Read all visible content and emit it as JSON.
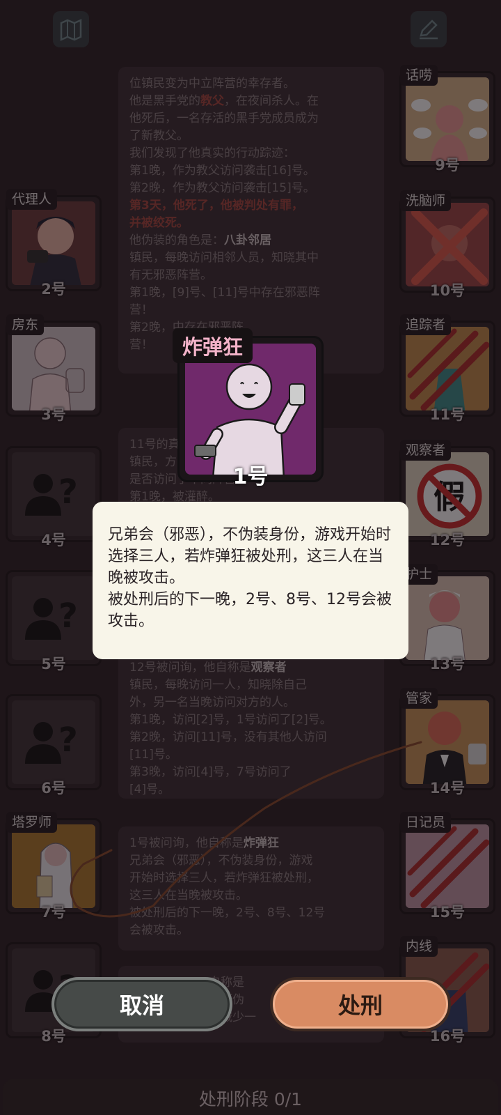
{
  "top_icons": {
    "left": "map-icon",
    "right": "note-icon"
  },
  "log_cards": [
    {
      "lines": [
        [
          {
            "t": "位镇民变为中立阵营的幸存者。",
            "c": ""
          }
        ],
        [
          {
            "t": "他是黑手党的",
            "c": ""
          },
          {
            "t": "教父",
            "c": "red"
          },
          {
            "t": "，在夜间杀人。在",
            "c": ""
          }
        ],
        [
          {
            "t": "他死后，一名存活的黑手党成员成为",
            "c": ""
          }
        ],
        [
          {
            "t": "了新教父。",
            "c": ""
          }
        ],
        [
          {
            "t": "我们发现了他真实的行动踪迹：",
            "c": ""
          }
        ],
        [
          {
            "t": "第1晚，作为教父访问袭击[16]号。",
            "c": ""
          }
        ],
        [
          {
            "t": "第2晚，作为教父访问袭击[15]号。",
            "c": ""
          }
        ],
        [
          {
            "t": "第3天，他死了，他被判处有罪，",
            "c": "red"
          }
        ],
        [
          {
            "t": "并被绞死。",
            "c": "red"
          }
        ],
        [
          {
            "t": " ",
            "c": ""
          }
        ],
        [
          {
            "t": "他伪装的角色是：",
            "c": ""
          },
          {
            "t": "八卦邻居",
            "c": "hl"
          }
        ],
        [
          {
            "t": "镇民，每晚访问相邻人员，知晓其中",
            "c": ""
          }
        ],
        [
          {
            "t": "有无邪恶阵营。",
            "c": ""
          }
        ],
        [
          {
            "t": "第1晚，[9]号、[11]号中存在邪恶阵",
            "c": ""
          }
        ],
        [
          {
            "t": "营！",
            "c": ""
          }
        ],
        [
          {
            "t": "第2晚，",
            "c": ""
          },
          {
            "t": "中存在邪恶阵",
            "c": ""
          }
        ],
        [
          {
            "t": "营！",
            "c": ""
          }
        ]
      ]
    },
    {
      "lines": [
        [
          {
            "t": "11号的真",
            "c": ""
          }
        ],
        [
          {
            "t": "镇民，",
            "c": ""
          },
          {
            "t": "方当晚",
            "c": ""
          }
        ],
        [
          {
            "t": "是否访问了不同阵营。",
            "c": ""
          }
        ],
        [
          {
            "t": "第1晚，被灌醉。",
            "c": ""
          }
        ]
      ]
    },
    {
      "lines": [
        [
          {
            "t": "12号被问询，他自称是",
            "c": ""
          },
          {
            "t": "观察者",
            "c": "hl"
          }
        ],
        [
          {
            "t": "镇民，每晚访问一人，知晓除自己",
            "c": ""
          }
        ],
        [
          {
            "t": "外，另一名当晚访问对方的人。",
            "c": ""
          }
        ],
        [
          {
            "t": "第1晚，访问[2]号，1号访问了[2]号。",
            "c": ""
          }
        ],
        [
          {
            "t": "第2晚，访问[11]号，没有其他人访问",
            "c": ""
          }
        ],
        [
          {
            "t": "[11]号。",
            "c": ""
          }
        ],
        [
          {
            "t": "第3晚，访问[4]号，7号访问了",
            "c": ""
          }
        ],
        [
          {
            "t": "[4]号。",
            "c": ""
          }
        ]
      ]
    },
    {
      "lines": [
        [
          {
            "t": "1号被问询，他自称是",
            "c": ""
          },
          {
            "t": "炸弹狂",
            "c": "hl"
          }
        ],
        [
          {
            "t": "兄弟会（邪恶），不伪装身份，游戏",
            "c": ""
          }
        ],
        [
          {
            "t": "开始时选择三人，若炸弹狂被处刑，",
            "c": ""
          }
        ],
        [
          {
            "t": "这三人在当晚被攻击。",
            "c": ""
          }
        ],
        [
          {
            "t": "被处刑后的下一晚，2号、8号、12号",
            "c": ""
          }
        ],
        [
          {
            "t": "会被攻击。",
            "c": ""
          }
        ]
      ]
    },
    {
      "lines": [
        [
          {
            "t": "自称是",
            "c": ""
          }
        ],
        [
          {
            "t": "，不伪",
            "c": ""
          }
        ],
        [
          {
            "t": "天减少一",
            "c": ""
          }
        ]
      ]
    }
  ],
  "left_seats": [
    {
      "role": "代理人",
      "num": "2号"
    },
    {
      "role": "房东",
      "num": "3号"
    },
    {
      "role": "",
      "num": "4号"
    },
    {
      "role": "",
      "num": "5号"
    },
    {
      "role": "",
      "num": "6号"
    },
    {
      "role": "塔罗师",
      "num": "7号"
    },
    {
      "role": "",
      "num": "8号"
    }
  ],
  "right_seats": [
    {
      "role": "话唠",
      "num": "9号"
    },
    {
      "role": "洗脑师",
      "num": "10号"
    },
    {
      "role": "追踪者",
      "num": "11号"
    },
    {
      "role": "观察者",
      "num": "12号"
    },
    {
      "role": "护士",
      "num": "13号"
    },
    {
      "role": "管家",
      "num": "14号"
    },
    {
      "role": "日记员",
      "num": "15号"
    },
    {
      "role": "内线",
      "num": "16号"
    }
  ],
  "focus": {
    "role": "炸弹狂",
    "num": "1号"
  },
  "popup": {
    "text1": "兄弟会（邪恶），不伪装身份，游戏开始时选择三人，若炸弹狂被处刑，这三人在当晚被攻击。",
    "text2": "被处刑后的下一晚，2号、8号、12号会被攻击。"
  },
  "buttons": {
    "cancel": "取消",
    "execute": "处刑"
  },
  "phase": "处刑阶段 0/1",
  "colors": {
    "accent": "#d98b63",
    "evil_red": "#a6463e",
    "popup_bg": "#f8f5e9",
    "bomber_bg": "#6f2c6b"
  }
}
